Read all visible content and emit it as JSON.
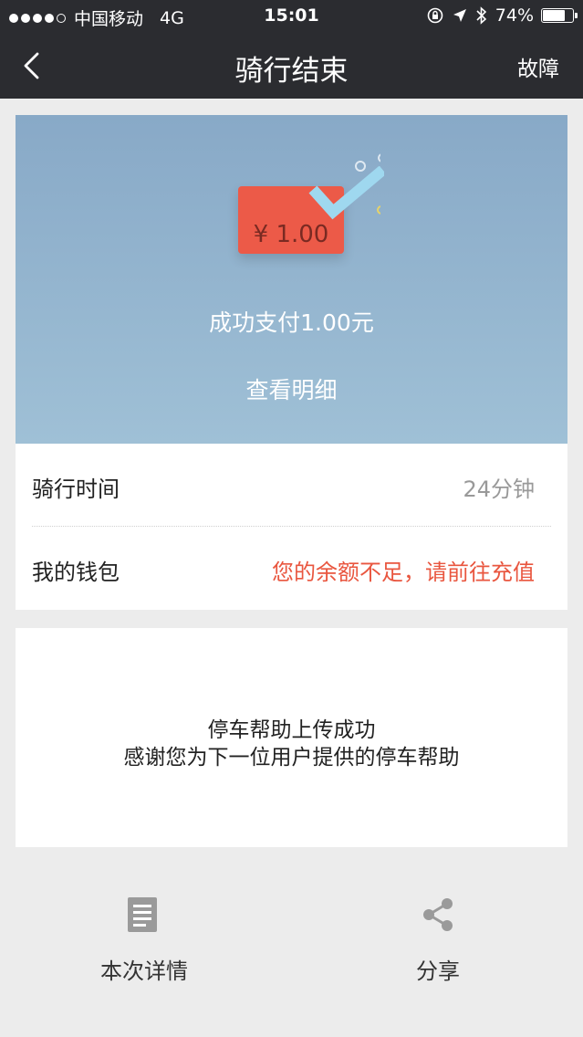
{
  "status_bar": {
    "carrier": "中国移动",
    "network": "4G",
    "time": "15:01",
    "battery": "74%",
    "battery_level": 0.74
  },
  "nav": {
    "title": "骑行结束",
    "right_action": "故障",
    "back_icon": "chevron-left-icon"
  },
  "hero": {
    "envelope_amount": "¥ 1.00",
    "payment_text": "成功支付1.00元",
    "detail_link": "查看明细",
    "colors": {
      "envelope": "#ec5a48",
      "check": "#9fd8ef"
    }
  },
  "info": {
    "ride_time_label": "骑行时间",
    "ride_time_value": "24分钟",
    "wallet_label": "我的钱包",
    "wallet_value": "您的余额不足，请前往充值",
    "warn_color": "#e9563f"
  },
  "message": {
    "line1": "停车帮助上传成功",
    "line2": "感谢您为下一位用户提供的停车帮助"
  },
  "actions": {
    "details_label": "本次详情",
    "details_icon": "document-icon",
    "share_label": "分享",
    "share_icon": "share-icon"
  }
}
